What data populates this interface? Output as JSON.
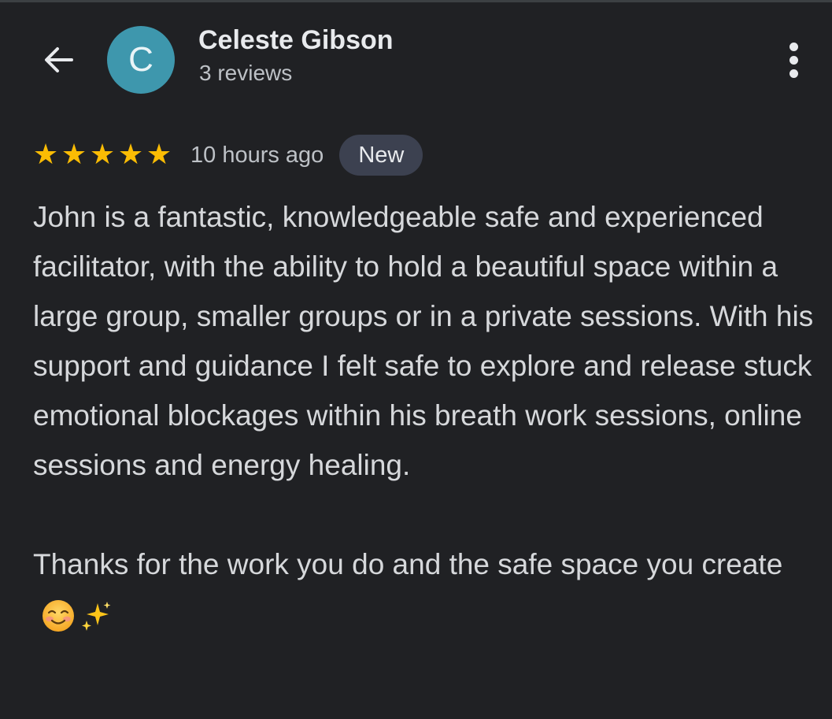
{
  "header": {
    "avatar_letter": "C",
    "avatar_color": "#3e97ad",
    "reviewer_name": "Celeste Gibson",
    "review_count": "3 reviews",
    "back_icon": "arrow-left-icon",
    "more_icon": "more-vert-icon"
  },
  "review": {
    "rating": 5,
    "rating_max": 5,
    "star_color": "#fbbc04",
    "star_glyph": "★",
    "time": "10 hours ago",
    "badge": "New",
    "paragraphs": [
      "John is a fantastic, knowledgeable safe and experienced facilitator, with the ability to hold a beautiful space within a large group, smaller groups or in a private sessions. With his support and guidance I felt safe to explore and release stuck emotional blockages within his breath work sessions, online sessions and energy healing.",
      "Thanks for the work you do and the safe space you create"
    ],
    "trailing_emoji": [
      "smiling-face-blush-emoji",
      "sparkles-emoji"
    ]
  },
  "colors": {
    "background": "#202124",
    "text_primary": "#e8eaed",
    "text_secondary": "#bdc1c6",
    "badge_bg": "#3c4150"
  }
}
